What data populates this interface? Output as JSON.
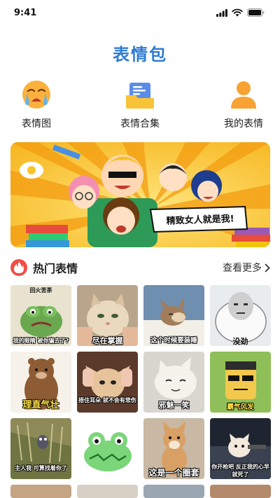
{
  "status": {
    "time": "9:41"
  },
  "app": {
    "title": "表情包"
  },
  "categories": [
    {
      "label": "表情图",
      "icon": "crying-face-icon"
    },
    {
      "label": "表情合集",
      "icon": "collection-folder-icon"
    },
    {
      "label": "我的表情",
      "icon": "user-person-icon"
    }
  ],
  "banner": {
    "caption": "精致女人就是我!"
  },
  "hot": {
    "title": "热门表情",
    "more": "查看更多",
    "tiles": [
      {
        "caption_top": "回火苦茶",
        "caption": "我的眼睛 被你骗去了?"
      },
      {
        "caption": "尽在掌握"
      },
      {
        "caption": "这个时候要装睡"
      },
      {
        "caption": "没劲"
      },
      {
        "caption": "理直气壮"
      },
      {
        "caption": "捂住耳朵 就不会有悲伤"
      },
      {
        "caption": "邪魅一笑"
      },
      {
        "caption": "霸气风发"
      },
      {
        "caption": "主人我 可算找着你了"
      },
      {
        "caption": ""
      },
      {
        "caption": "这是一个圈套"
      },
      {
        "caption": "你开枪吧 反正我的心早就死了"
      }
    ]
  },
  "colors": {
    "accent": "#2e7bd6",
    "hot": "#f14e47",
    "orange": "#f7a233"
  }
}
